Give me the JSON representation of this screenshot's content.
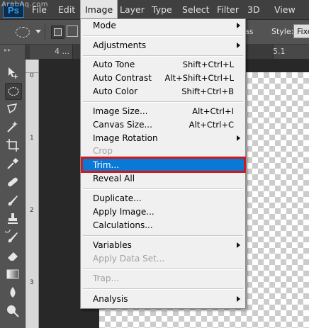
{
  "app": {
    "logo_text": "Ps",
    "watermark": "ArabAq.com"
  },
  "menubar": {
    "items": [
      {
        "label": "File"
      },
      {
        "label": "Edit"
      },
      {
        "label": "Image"
      },
      {
        "label": "Layer"
      },
      {
        "label": "Type"
      },
      {
        "label": "Select"
      },
      {
        "label": "Filter"
      },
      {
        "label": "3D"
      },
      {
        "label": "View"
      }
    ]
  },
  "options_bar": {
    "as_fragment": "as",
    "style_label": "Style:",
    "style_value": "Fixed"
  },
  "tabs": {
    "tab1": "4 ...",
    "tab1_ellipsis": "...",
    "tab2": "5.1"
  },
  "ruler": {
    "labels": [
      "0",
      "1",
      "2",
      "3"
    ]
  },
  "image_menu": {
    "items": [
      {
        "label": "Mode",
        "submenu": true
      },
      {
        "label": "Adjustments",
        "submenu": true
      },
      {
        "label": "Auto Tone",
        "shortcut": "Shift+Ctrl+L"
      },
      {
        "label": "Auto Contrast",
        "shortcut": "Alt+Shift+Ctrl+L"
      },
      {
        "label": "Auto Color",
        "shortcut": "Shift+Ctrl+B"
      },
      {
        "label": "Image Size...",
        "shortcut": "Alt+Ctrl+I"
      },
      {
        "label": "Canvas Size...",
        "shortcut": "Alt+Ctrl+C"
      },
      {
        "label": "Image Rotation",
        "submenu": true
      },
      {
        "label": "Crop",
        "disabled": true
      },
      {
        "label": "Trim...",
        "highlighted": true
      },
      {
        "label": "Reveal All"
      },
      {
        "label": "Duplicate..."
      },
      {
        "label": "Apply Image..."
      },
      {
        "label": "Calculations..."
      },
      {
        "label": "Variables",
        "submenu": true
      },
      {
        "label": "Apply Data Set...",
        "disabled": true
      },
      {
        "label": "Trap...",
        "disabled": true
      },
      {
        "label": "Analysis",
        "submenu": true
      }
    ]
  },
  "colors": {
    "highlight": "#0a78d7",
    "annotation_box": "#d01a1a"
  },
  "icons": [
    "move-icon",
    "elliptical-marquee-icon",
    "lasso-icon",
    "magic-wand-icon",
    "crop-icon",
    "eyedropper-icon",
    "healing-brush-icon",
    "brush-icon",
    "clone-stamp-icon",
    "history-brush-icon",
    "eraser-icon",
    "gradient-icon",
    "blur-icon",
    "dodge-icon"
  ]
}
